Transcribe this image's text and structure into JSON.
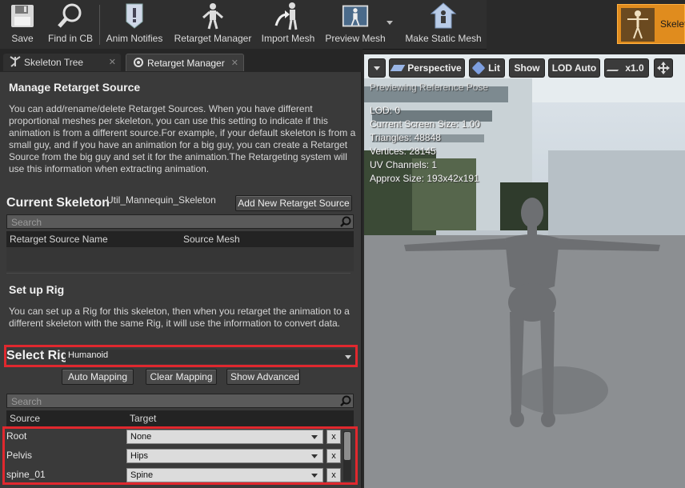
{
  "toolbar": {
    "buttons": [
      {
        "label": "Save",
        "icon": "save-icon"
      },
      {
        "label": "Find in CB",
        "icon": "find-in-cb-icon"
      },
      {
        "label": "Anim Notifies",
        "icon": "anim-notifies-icon"
      },
      {
        "label": "Retarget Manager",
        "icon": "retarget-manager-icon"
      },
      {
        "label": "Import Mesh",
        "icon": "import-mesh-icon"
      },
      {
        "label": "Preview Mesh",
        "icon": "preview-mesh-icon"
      },
      {
        "label": "Make Static Mesh",
        "icon": "make-static-mesh-icon"
      }
    ],
    "asset_tab_label": "Skelet"
  },
  "tabs": [
    {
      "label": "Skeleton Tree",
      "icon": "skeleton-tree-icon"
    },
    {
      "label": "Retarget Manager",
      "icon": "retarget-manager-tab-icon"
    }
  ],
  "retarget_source": {
    "heading": "Manage Retarget Source",
    "description": "You can add/rename/delete Retarget Sources. When you have different proportional meshes per skeleton, you can use this setting to indicate if this animation is from a different source.For example, if your default skeleton is from a small guy, and if you have an animation for a big guy, you can create a Retarget Source from the big guy and set it for the animation.The Retargeting system will use this information when extracting animation.",
    "current_skeleton_label": "Current Skeleton",
    "current_skeleton_value": "Util_Mannequin_Skeleton",
    "add_button": "Add New Retarget Source",
    "search_placeholder": "Search",
    "columns": [
      "Retarget Source Name",
      "Source Mesh"
    ]
  },
  "rig": {
    "heading": "Set up Rig",
    "description": "You can set up a Rig for this skeleton, then when you retarget the animation to a different skeleton with the same Rig, it will use the information to convert data.",
    "select_label": "Select Rig",
    "selected_rig": "Humanoid",
    "buttons": [
      "Auto  Mapping",
      "Clear Mapping",
      "Show Advanced"
    ],
    "search_placeholder": "Search",
    "columns": [
      "Source",
      "Target"
    ],
    "mappings": [
      {
        "source": "Root",
        "target": "None"
      },
      {
        "source": "Pelvis",
        "target": "Hips"
      },
      {
        "source": "spine_01",
        "target": "Spine"
      }
    ],
    "clear_label": "x"
  },
  "viewport": {
    "buttons": [
      "Perspective",
      "Lit",
      "Show",
      "LOD Auto",
      "x1.0"
    ],
    "preview_label": "Previewing Reference Pose",
    "stats": [
      "LOD: 0",
      "Current Screen Size: 1.00",
      "Triangles: 48848",
      "Vertices: 28145",
      "UV Channels: 1",
      "Approx Size: 193x42x191"
    ]
  }
}
